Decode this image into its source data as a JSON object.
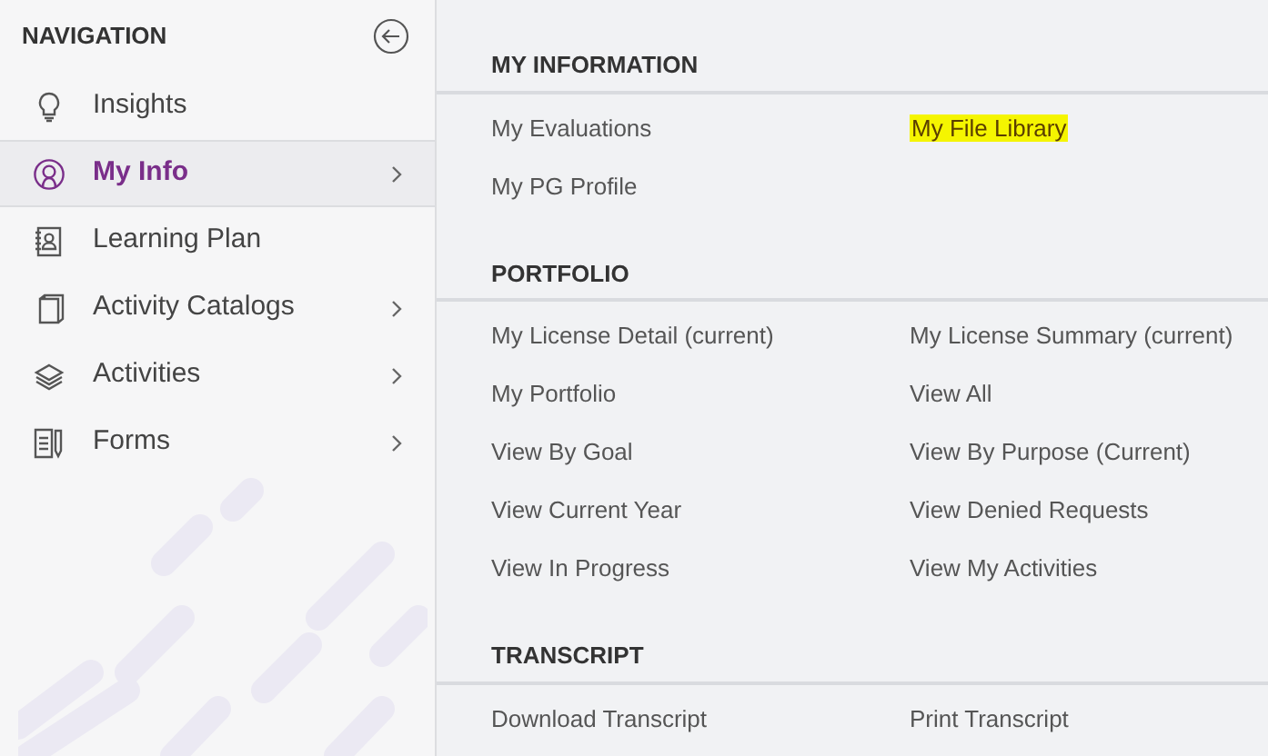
{
  "sidebar": {
    "title": "NAVIGATION",
    "items": [
      {
        "label": "Insights",
        "kind": "bulb",
        "selected": false,
        "has_submenu": false
      },
      {
        "label": "My Info",
        "kind": "person",
        "selected": true,
        "has_submenu": true
      },
      {
        "label": "Learning Plan",
        "kind": "contact",
        "selected": false,
        "has_submenu": false
      },
      {
        "label": "Activity Catalogs",
        "kind": "book",
        "selected": false,
        "has_submenu": true
      },
      {
        "label": "Activities",
        "kind": "layers",
        "selected": false,
        "has_submenu": true
      },
      {
        "label": "Forms",
        "kind": "form",
        "selected": false,
        "has_submenu": true
      }
    ]
  },
  "sections": [
    {
      "title": "MY INFORMATION",
      "links": [
        {
          "label": "My Evaluations",
          "highlighted": false
        },
        {
          "label": "My File Library",
          "highlighted": true
        },
        {
          "label": "My PG Profile",
          "highlighted": false
        }
      ]
    },
    {
      "title": "PORTFOLIO",
      "links": [
        {
          "label": "My License Detail (current)",
          "highlighted": false
        },
        {
          "label": "My License Summary (current)",
          "highlighted": false
        },
        {
          "label": "My Portfolio",
          "highlighted": false
        },
        {
          "label": "View All",
          "highlighted": false
        },
        {
          "label": "View By Goal",
          "highlighted": false
        },
        {
          "label": "View By Purpose (Current)",
          "highlighted": false
        },
        {
          "label": "View Current Year",
          "highlighted": false
        },
        {
          "label": "View Denied Requests",
          "highlighted": false
        },
        {
          "label": "View In Progress",
          "highlighted": false
        },
        {
          "label": "View My Activities",
          "highlighted": false
        }
      ]
    },
    {
      "title": "TRANSCRIPT",
      "links": [
        {
          "label": "Download Transcript",
          "highlighted": false
        },
        {
          "label": "Print Transcript",
          "highlighted": false
        }
      ]
    }
  ]
}
